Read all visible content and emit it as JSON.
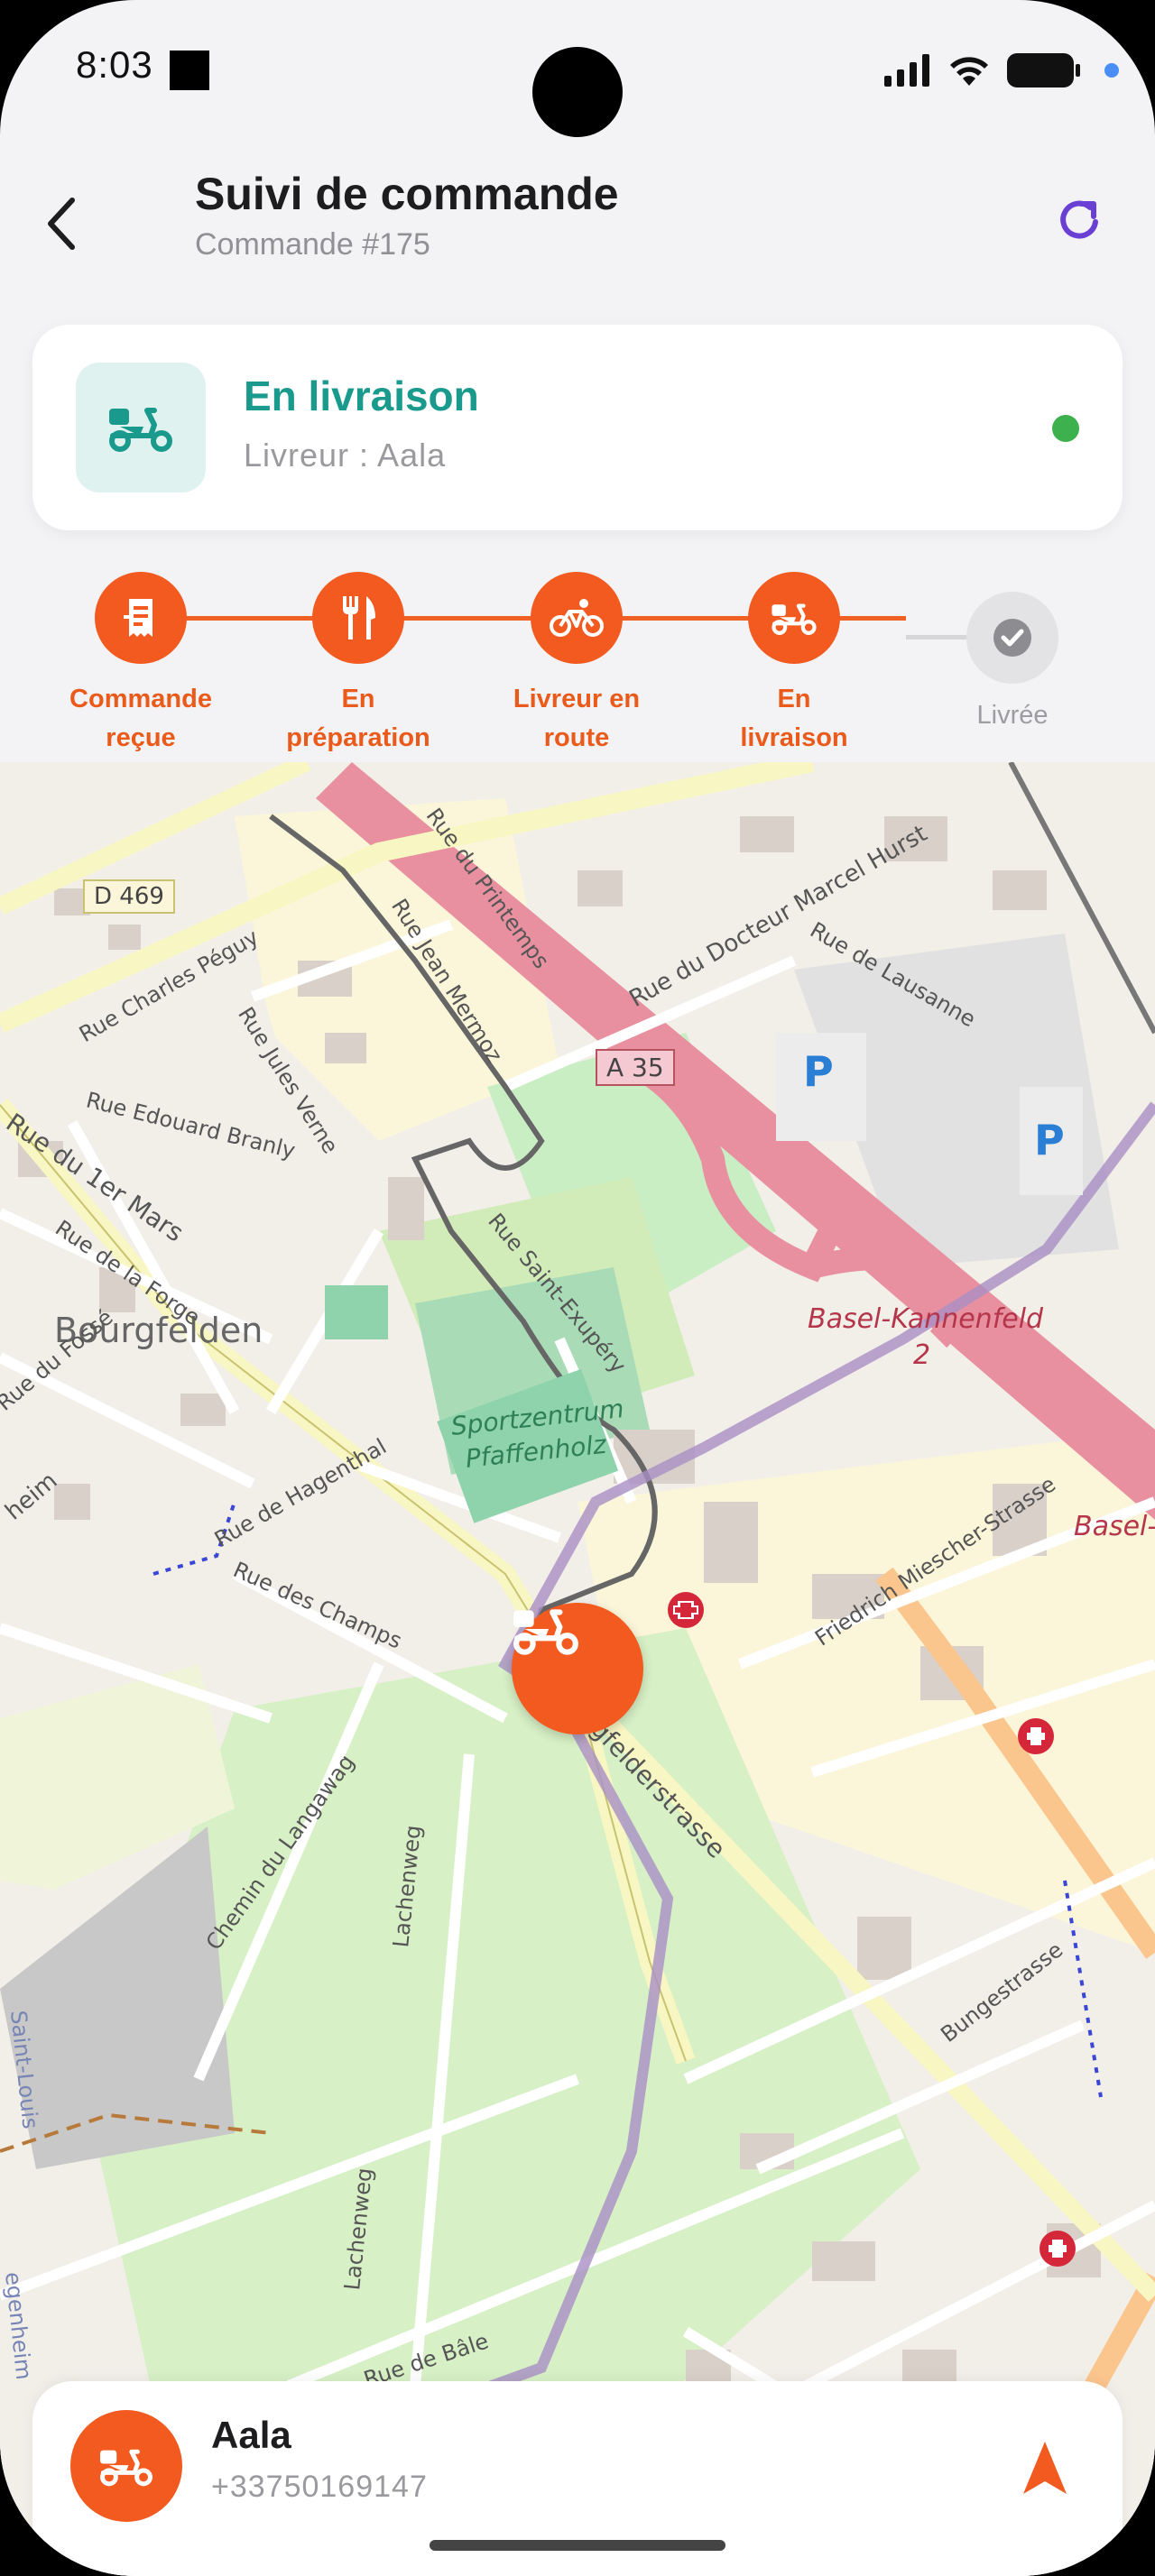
{
  "status_bar": {
    "time": "8:03"
  },
  "header": {
    "title": "Suivi de commande",
    "order_number": "Commande #175"
  },
  "status_card": {
    "title": "En livraison",
    "courier_line": "Livreur : Aala",
    "live_color": "#3cb14d"
  },
  "steps": [
    {
      "label_line1": "Commande",
      "label_line2": "reçue",
      "icon": "receipt-icon",
      "done": true
    },
    {
      "label_line1": "En",
      "label_line2": "préparation",
      "icon": "fork-knife-icon",
      "done": true
    },
    {
      "label_line1": "Livreur en",
      "label_line2": "route",
      "icon": "bicycle-icon",
      "done": true
    },
    {
      "label_line1": "En",
      "label_line2": "livraison",
      "icon": "scooter-icon",
      "done": true
    },
    {
      "label_line1": "Livrée",
      "label_line2": "",
      "icon": "check-icon",
      "done": false
    }
  ],
  "map": {
    "labels": {
      "d469": "D 469",
      "a35": "A 35",
      "bourgfelden": "Bourgfelden",
      "sportzentrum_1": "Sportzentrum",
      "sportzentrum_2": "Pfaffenholz",
      "basel_kannenfeld": "Basel-Kannenfeld",
      "kannenfeld_2": "2",
      "basel_edge": "Basel-",
      "rue_printemps": "Rue du Printemps",
      "rue_jean_mermoz": "Rue Jean Mermoz",
      "rue_docteur": "Rue du Docteur Marcel Hurst",
      "rue_lausanne": "Rue de Lausanne",
      "rue_charles_peguy": "Rue Charles Péguy",
      "rue_jules_verne": "Rue Jules Verne",
      "rue_edouard_branly": "Rue Edouard Branly",
      "rue_1er_mars": "Rue du 1er Mars",
      "rue_forge": "Rue de la Forge",
      "rue_fosse": "Rue du Fossé",
      "rue_saint_exupery": "Rue Saint-Exupéry",
      "rue_hagenthal": "Rue de Hagenthal",
      "rue_champs": "Rue des Champs",
      "friedrich": "Friedrich Miescher-Strasse",
      "felderstrasse": "gfelderstrasse",
      "chemin_langawag": "Chemin du Langawag",
      "lachenweg_1": "Lachenweg",
      "lachenweg_2": "Lachenweg",
      "bungestrasse": "Bungestrasse",
      "rue_bale": "Rue de Bâle",
      "saint_louis": "Saint-Louis",
      "hegenheim": "egenheim",
      "heim": "heim",
      "parking": "P"
    }
  },
  "courier": {
    "name": "Aala",
    "phone": "+33750169147"
  },
  "colors": {
    "accent": "#f25a1f",
    "teal": "#1a9a8c",
    "purple": "#6a3fd4"
  }
}
